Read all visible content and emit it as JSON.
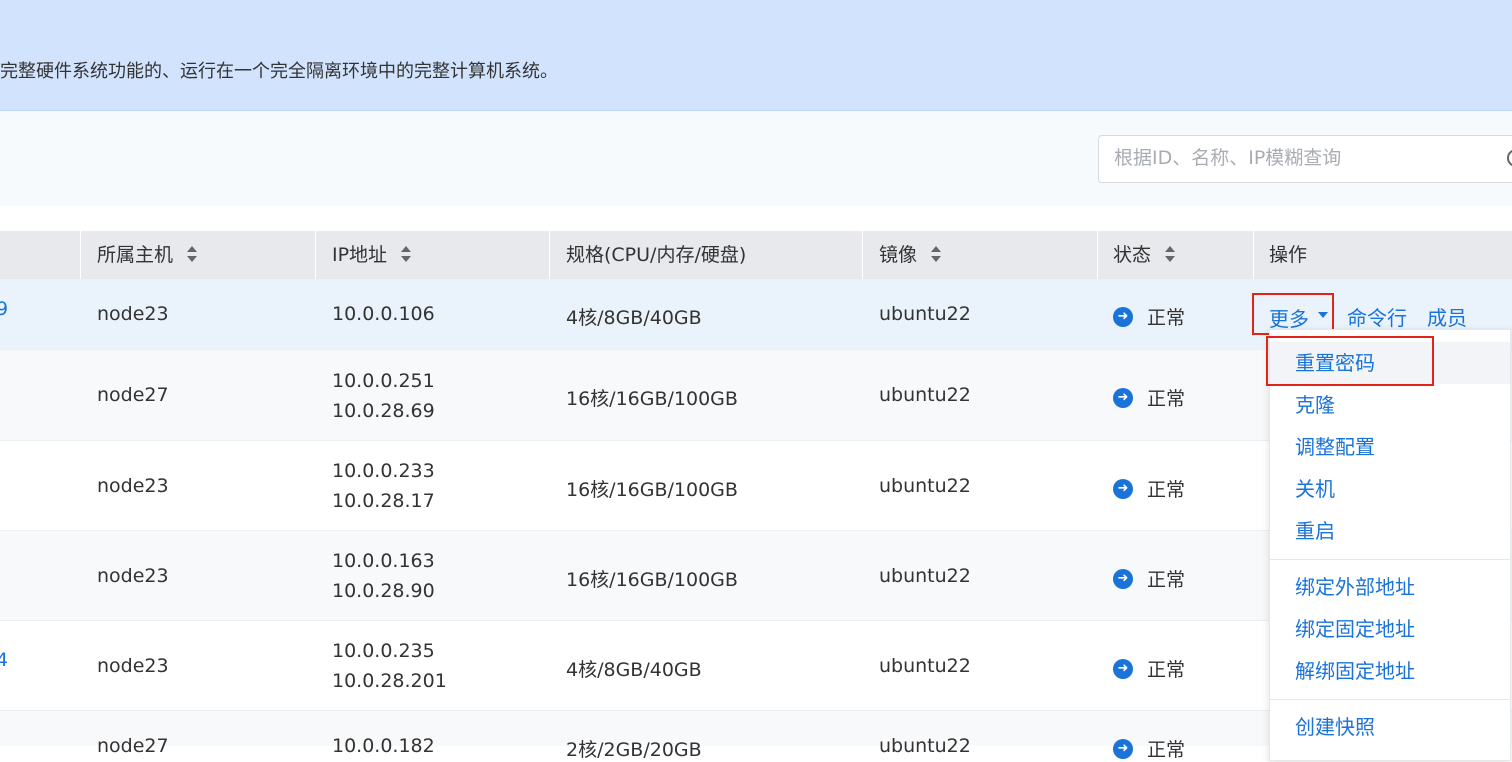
{
  "banner": {
    "text": "完整硬件系统功能的、运行在一个完全隔离环境中的完整计算机系统。"
  },
  "search": {
    "placeholder": "根据ID、名称、IP模糊查询"
  },
  "table": {
    "headers": {
      "host": "所属主机",
      "ip": "IP地址",
      "spec": "规格(CPU/内存/硬盘)",
      "image": "镜像",
      "status": "状态",
      "ops": "操作"
    },
    "rows": [
      {
        "id_tail": "9",
        "host": "node23",
        "ip": [
          "10.0.0.106"
        ],
        "spec": "4核/8GB/40GB",
        "image": "ubuntu22",
        "status": "正常"
      },
      {
        "id_tail": "",
        "host": "node27",
        "ip": [
          "10.0.0.251",
          "10.0.28.69"
        ],
        "spec": "16核/16GB/100GB",
        "image": "ubuntu22",
        "status": "正常"
      },
      {
        "id_tail": "",
        "host": "node23",
        "ip": [
          "10.0.0.233",
          "10.0.28.17"
        ],
        "spec": "16核/16GB/100GB",
        "image": "ubuntu22",
        "status": "正常"
      },
      {
        "id_tail": "",
        "host": "node23",
        "ip": [
          "10.0.0.163",
          "10.0.28.90"
        ],
        "spec": "16核/16GB/100GB",
        "image": "ubuntu22",
        "status": "正常"
      },
      {
        "id_tail": "4",
        "host": "node23",
        "ip": [
          "10.0.0.235",
          "10.0.28.201"
        ],
        "spec": "4核/8GB/40GB",
        "image": "ubuntu22",
        "status": "正常"
      },
      {
        "id_tail": "",
        "host": "node27",
        "ip": [
          "10.0.0.182"
        ],
        "spec": "2核/2GB/20GB",
        "image": "ubuntu22",
        "status": "正常"
      }
    ]
  },
  "actions": {
    "more": "更多",
    "terminal": "命令行",
    "members": "成员"
  },
  "dropdown": {
    "items": [
      "重置密码",
      "克隆",
      "调整配置",
      "关机",
      "重启",
      "绑定外部地址",
      "绑定固定地址",
      "解绑固定地址",
      "创建快照"
    ]
  },
  "colors": {
    "accent": "#1a73d9",
    "banner_bg": "#d2e4fd",
    "highlight": "#e2231a"
  }
}
